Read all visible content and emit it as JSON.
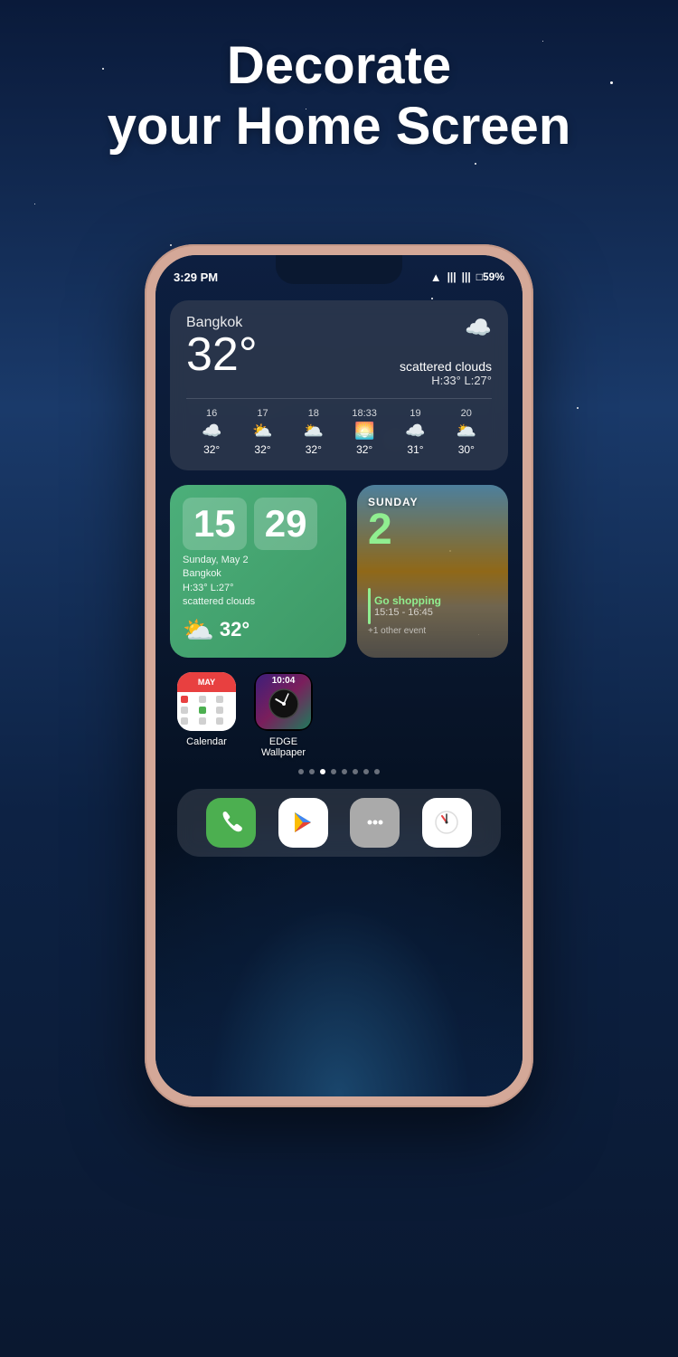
{
  "background": {
    "gradient_start": "#0a1a3a",
    "gradient_end": "#0a1830"
  },
  "header": {
    "line1": "Decorate",
    "line2": "your Home Screen"
  },
  "phone": {
    "status_bar": {
      "time": "3:29 PM",
      "battery": "59%"
    },
    "weather_widget": {
      "city": "Bangkok",
      "temp": "32°",
      "condition": "scattered clouds",
      "high": "H:33°",
      "low": "L:27°",
      "hourly": [
        {
          "time": "16",
          "icon": "☁️",
          "temp": "32°"
        },
        {
          "time": "17",
          "icon": "⛅",
          "temp": "32°"
        },
        {
          "time": "18",
          "icon": "🌥️",
          "temp": "32°"
        },
        {
          "time": "18:33",
          "icon": "🌅",
          "temp": "32°"
        },
        {
          "time": "19",
          "icon": "☁️",
          "temp": "31°"
        },
        {
          "time": "20",
          "icon": "🌥️",
          "temp": "30°"
        }
      ]
    },
    "clock_widget": {
      "hour": "15",
      "minute": "29",
      "date": "Sunday, May 2",
      "city": "Bangkok",
      "high": "H:33°",
      "low": "L:27°",
      "condition": "scattered clouds",
      "temp": "32°"
    },
    "calendar_widget": {
      "day": "SUNDAY",
      "date": "2",
      "event": {
        "title": "Go shopping",
        "time": "15:15 - 16:45",
        "other": "+1 other event"
      }
    },
    "apps": [
      {
        "id": "calendar",
        "label": "Calendar"
      },
      {
        "id": "edge-wallpaper",
        "label": "EDGE\nWallpaper",
        "time": "10:04"
      }
    ],
    "page_dots": [
      0,
      1,
      2,
      3,
      4,
      5,
      6,
      7
    ],
    "active_dot": 2,
    "dock": [
      {
        "id": "phone",
        "label": "Phone",
        "color": "#4caf50"
      },
      {
        "id": "play-store",
        "label": "Play Store",
        "color": "white"
      },
      {
        "id": "messages",
        "label": "Messages",
        "color": "#666"
      },
      {
        "id": "clock",
        "label": "Clock",
        "color": "white"
      }
    ]
  }
}
